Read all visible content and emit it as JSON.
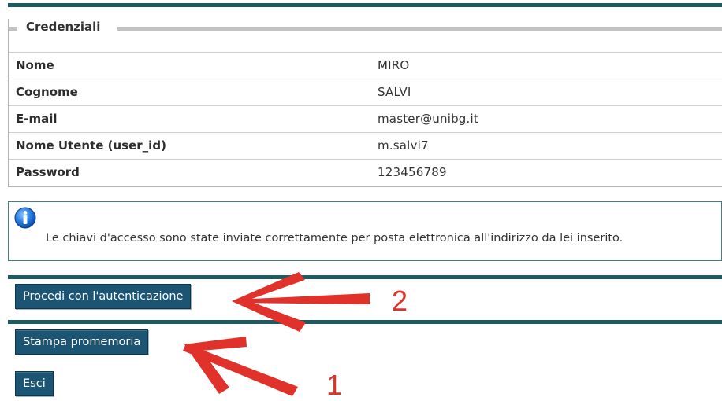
{
  "credentials": {
    "legend": "Credenziali",
    "rows": [
      {
        "label": "Nome",
        "value": "MIRO"
      },
      {
        "label": "Cognome",
        "value": "SALVI"
      },
      {
        "label": "E-mail",
        "value": "master@unibg.it"
      },
      {
        "label": "Nome Utente (user_id)",
        "value": "m.salvi7"
      },
      {
        "label": "Password",
        "value": "123456789"
      }
    ]
  },
  "info": {
    "icon": "info-icon",
    "message": "Le chiavi d'accesso sono state inviate correttamente per posta elettronica all'indirizzo da lei inserito."
  },
  "actions": {
    "authenticate_label": "Procedi con l'autenticazione",
    "print_label": "Stampa promemoria",
    "exit_label": "Esci"
  },
  "annotations": {
    "label_one": "1",
    "label_two": "2",
    "color": "#e0322b"
  },
  "colors": {
    "accent": "#1d5a63",
    "button": "#1c5573"
  }
}
